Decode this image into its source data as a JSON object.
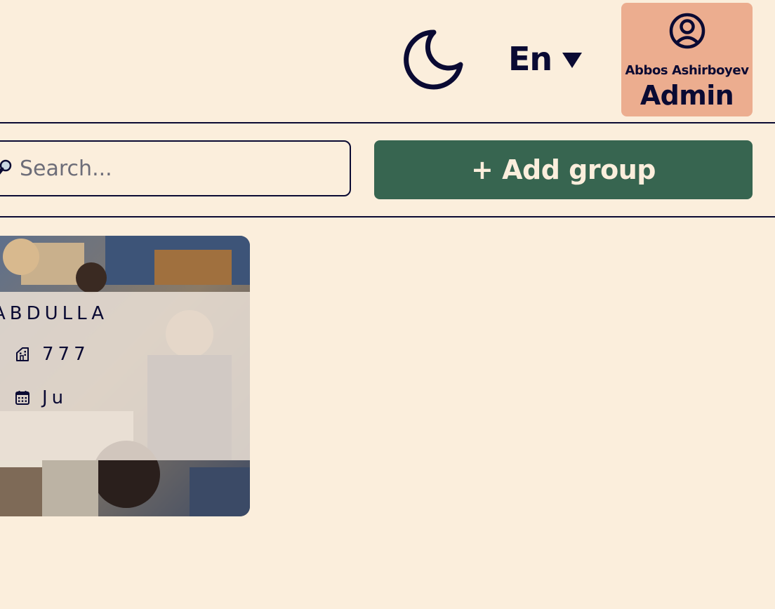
{
  "header": {
    "theme_icon": "moon-icon",
    "language": {
      "selected": "En",
      "caret_icon": "caret-down-icon"
    },
    "profile": {
      "icon": "user-circle-icon",
      "name": "Abbos Ashirboyev",
      "role": "Admin"
    }
  },
  "toolbar": {
    "search": {
      "icon": "magnifier-icon",
      "placeholder": "Search...",
      "value": ""
    },
    "add_group_label": "+ Add group"
  },
  "groups": [
    {
      "name": "ABDULLA",
      "room_icon": "building-icon",
      "room": "777",
      "days_icon": "calendar-icon",
      "days": "Ju"
    }
  ],
  "colors": {
    "background": "#fbeedc",
    "text": "#0a0a33",
    "profile_bg": "#ecad8f",
    "primary_button": "#376550",
    "button_text": "#fbeedc"
  }
}
